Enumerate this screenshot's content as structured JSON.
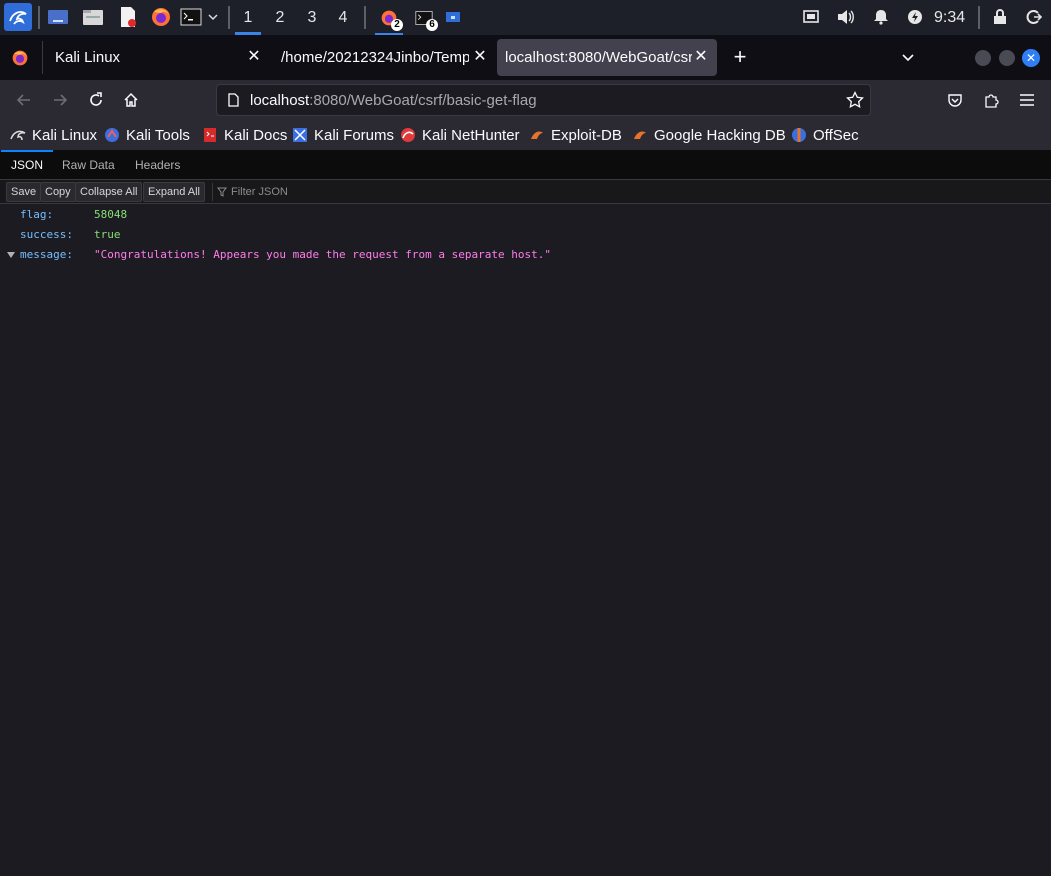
{
  "panel": {
    "workspaces": [
      "1",
      "2",
      "3",
      "4"
    ],
    "active_workspace": "1",
    "firefox_badge": "2",
    "terminal_badge": "6",
    "clock": "9:34"
  },
  "tabs": [
    {
      "label": "Kali Linux",
      "selected": false
    },
    {
      "label": "/home/20212324Jinbo/Temp",
      "selected": false
    },
    {
      "label": "localhost:8080/WebGoat/csr",
      "selected": true
    }
  ],
  "urlbar": {
    "host": "localhost",
    "path": ":8080/WebGoat/csrf/basic-get-flag"
  },
  "bookmarks": [
    {
      "label": "Kali Linux",
      "icon": "kali-dragon-icon"
    },
    {
      "label": "Kali Tools",
      "icon": "kali-tools-icon"
    },
    {
      "label": "Kali Docs",
      "icon": "kali-docs-icon"
    },
    {
      "label": "Kali Forums",
      "icon": "kali-forums-icon"
    },
    {
      "label": "Kali NetHunter",
      "icon": "nethunter-icon"
    },
    {
      "label": "Exploit-DB",
      "icon": "exploit-db-icon"
    },
    {
      "label": "Google Hacking DB",
      "icon": "ghdb-icon"
    },
    {
      "label": "OffSec",
      "icon": "offsec-icon"
    }
  ],
  "json_viewer": {
    "tabs": [
      "JSON",
      "Raw Data",
      "Headers"
    ],
    "active_tab": "JSON",
    "toolbar": {
      "save": "Save",
      "copy": "Copy",
      "collapse_all": "Collapse All",
      "expand_all": "Expand All",
      "filter_placeholder": "Filter JSON"
    },
    "rows": [
      {
        "key": "flag:",
        "value": "58048",
        "type": "number"
      },
      {
        "key": "success:",
        "value": "true",
        "type": "boolean"
      },
      {
        "key": "message:",
        "value": "\"Congratulations! Appears you made the request from a separate host.\"",
        "type": "string"
      }
    ]
  },
  "colors": {
    "accent": "#0a84ff",
    "key": "#75bfff",
    "number": "#86de74",
    "string": "#ff7de9"
  }
}
